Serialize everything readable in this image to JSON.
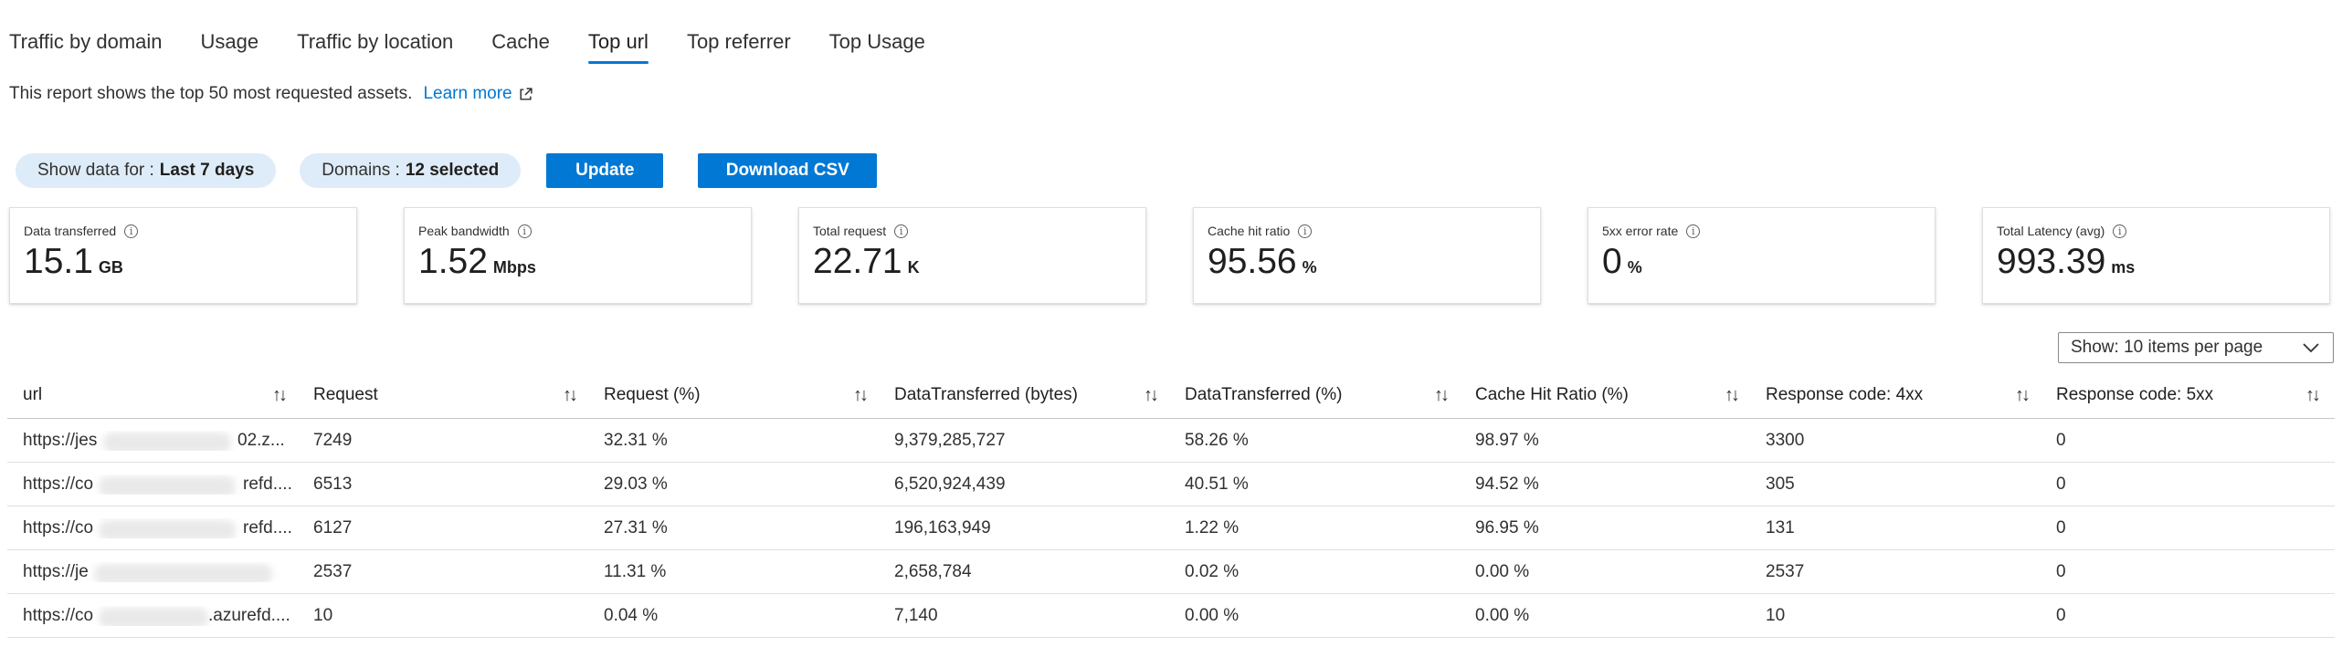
{
  "tabs": [
    {
      "label": "Traffic by domain",
      "active": false
    },
    {
      "label": "Usage",
      "active": false
    },
    {
      "label": "Traffic by location",
      "active": false
    },
    {
      "label": "Cache",
      "active": false
    },
    {
      "label": "Top url",
      "active": true
    },
    {
      "label": "Top referrer",
      "active": false
    },
    {
      "label": "Top Usage",
      "active": false
    }
  ],
  "description": {
    "text": "This report shows the top 50 most requested assets.",
    "link_label": "Learn more"
  },
  "filters": {
    "date_prefix": "Show data for :",
    "date_value": "Last 7 days",
    "domains_prefix": "Domains :",
    "domains_value": "12 selected",
    "update_label": "Update",
    "download_label": "Download CSV"
  },
  "metrics": [
    {
      "label": "Data transferred",
      "value": "15.1",
      "unit": "GB"
    },
    {
      "label": "Peak bandwidth",
      "value": "1.52",
      "unit": "Mbps"
    },
    {
      "label": "Total request",
      "value": "22.71",
      "unit": "K"
    },
    {
      "label": "Cache hit ratio",
      "value": "95.56",
      "unit": "%"
    },
    {
      "label": "5xx error rate",
      "value": "0",
      "unit": "%"
    },
    {
      "label": "Total Latency (avg)",
      "value": "993.39",
      "unit": "ms"
    }
  ],
  "pagination": {
    "items_per_page_label": "Show: 10 items per page"
  },
  "table": {
    "columns": [
      "url",
      "Request",
      "Request (%)",
      "DataTransferred (bytes)",
      "DataTransferred (%)",
      "Cache Hit Ratio (%)",
      "Response code: 4xx",
      "Response code: 5xx"
    ],
    "rows": [
      [
        "https://jes",
        "7249",
        "32.31 %",
        "9,379,285,727",
        "58.26 %",
        "98.97 %",
        "3300",
        "0"
      ],
      [
        "https://co",
        "6513",
        "29.03 %",
        "6,520,924,439",
        "40.51 %",
        "94.52 %",
        "305",
        "0"
      ],
      [
        "https://co",
        "6127",
        "27.31 %",
        "196,163,949",
        "1.22 %",
        "96.95 %",
        "131",
        "0"
      ],
      [
        "https://je",
        "2537",
        "11.31 %",
        "2,658,784",
        "0.02 %",
        "0.00 %",
        "2537",
        "0"
      ],
      [
        "https://co",
        "10",
        "0.04 %",
        "7,140",
        "0.00 %",
        "0.00 %",
        "10",
        "0"
      ]
    ],
    "url_suffixes": [
      "02.z...",
      "refd....",
      "refd....",
      "",
      ".azurefd...."
    ],
    "sort_icon": "sort-arrows-icon"
  },
  "icons": {
    "info": "info-icon",
    "external": "external-link-icon",
    "chevron": "chevron-down-icon"
  },
  "colors": {
    "accent": "#0078d4",
    "pill": "#deecf9",
    "text": "#323130"
  }
}
